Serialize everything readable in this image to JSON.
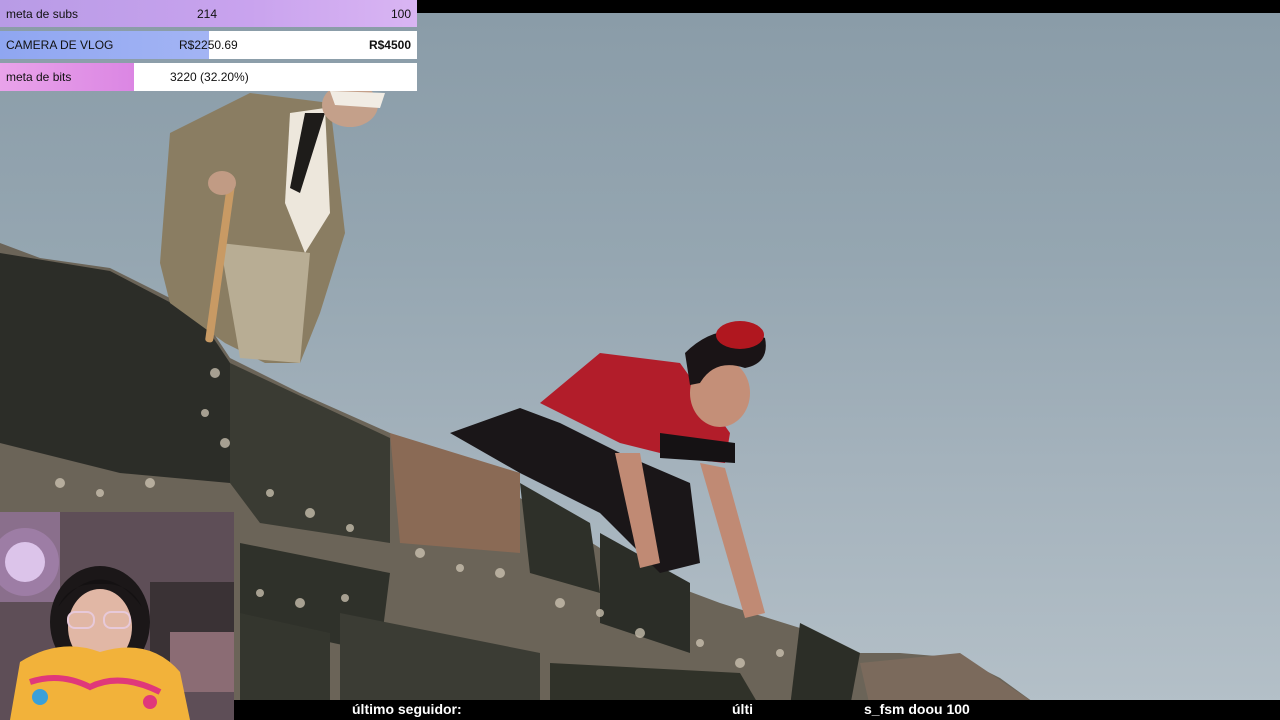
{
  "goals": [
    {
      "label": "meta de subs",
      "current": "214",
      "target": "100",
      "progress": 1.0,
      "color": "#c9a3ee"
    },
    {
      "label": "CAMERA DE VLOG",
      "current": "R$2250.69",
      "target": "R$4500",
      "progress": 0.5,
      "color": "#9aaef3"
    },
    {
      "label": "meta de bits",
      "current": "3220 (32.20%)",
      "progress": 0.322,
      "color": "#e39ae7"
    }
  ],
  "ticker": {
    "last_follower": "último seguidor:",
    "partial": "últi",
    "donation": "s_fsm doou 100"
  }
}
